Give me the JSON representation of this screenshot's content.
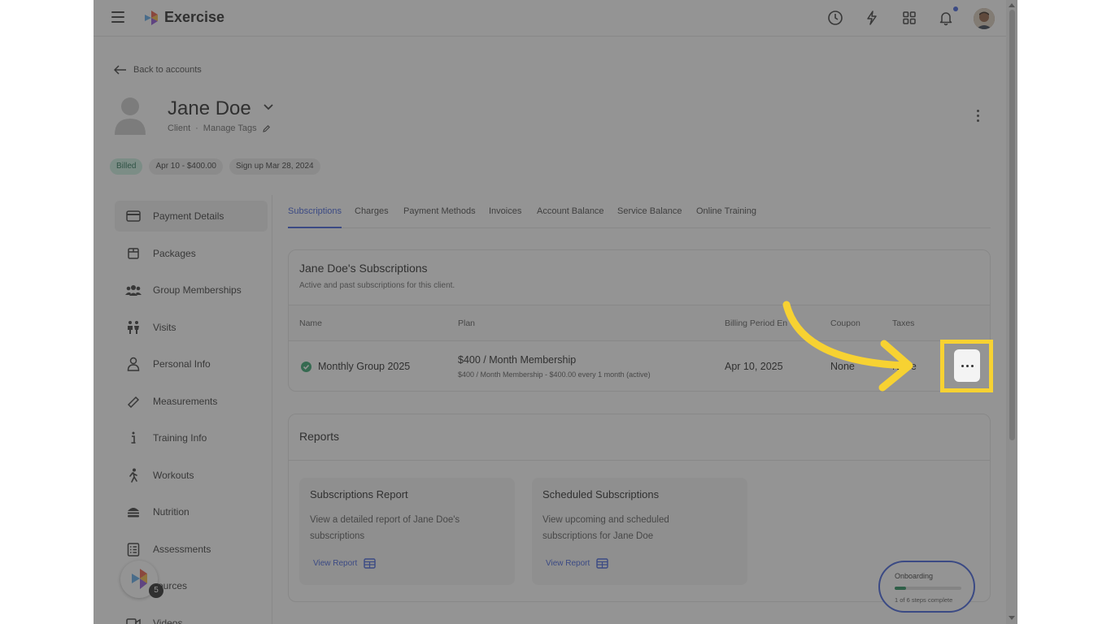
{
  "app": {
    "title": "Exercise"
  },
  "nav": {
    "back_label": "Back to accounts"
  },
  "client": {
    "name": "Jane Doe",
    "role": "Client",
    "separator": "·",
    "manage_tags": "Manage Tags"
  },
  "chips": {
    "billed": "Billed",
    "next_bill": "Apr 10 - $400.00",
    "signup": "Sign up Mar 28, 2024"
  },
  "sidebar": {
    "items": [
      {
        "label": "Payment Details",
        "icon": "credit-card-icon"
      },
      {
        "label": "Packages",
        "icon": "package-icon"
      },
      {
        "label": "Group Memberships",
        "icon": "group-icon"
      },
      {
        "label": "Visits",
        "icon": "visits-icon"
      },
      {
        "label": "Personal Info",
        "icon": "person-icon"
      },
      {
        "label": "Measurements",
        "icon": "ruler-icon"
      },
      {
        "label": "Training Info",
        "icon": "info-icon"
      },
      {
        "label": "Workouts",
        "icon": "running-icon"
      },
      {
        "label": "Nutrition",
        "icon": "burger-icon"
      },
      {
        "label": "Assessments",
        "icon": "checklist-icon"
      },
      {
        "label": "sources",
        "icon": "resources-icon"
      },
      {
        "label": "Videos",
        "icon": "video-icon"
      }
    ]
  },
  "tabs": [
    "Subscriptions",
    "Charges",
    "Payment Methods",
    "Invoices",
    "Account Balance",
    "Service Balance",
    "Online Training"
  ],
  "subscriptions": {
    "title": "Jane Doe's Subscriptions",
    "subtitle": "Active and past subscriptions for this client.",
    "columns": [
      "Name",
      "Plan",
      "Billing Period En",
      "Coupon",
      "Taxes"
    ],
    "row": {
      "name": "Monthly Group 2025",
      "plan": "$400 / Month Membership",
      "plan_detail": "$400 / Month Membership - $400.00 every 1 month (active)",
      "billing_end": "Apr 10, 2025",
      "coupon": "None",
      "taxes": "None"
    }
  },
  "reports": {
    "title": "Reports",
    "cards": [
      {
        "title": "Subscriptions Report",
        "desc": "View a detailed report of Jane Doe's subscriptions",
        "link": "View Report"
      },
      {
        "title": "Scheduled Subscriptions",
        "desc": "View upcoming and scheduled subscriptions for Jane Doe",
        "link": "View Report"
      }
    ]
  },
  "onboarding": {
    "title": "Onboarding",
    "progress": "1 of 6 steps complete",
    "fraction": 0.17
  },
  "fab": {
    "badge": "5"
  },
  "colors": {
    "accent": "#3b5bdb",
    "highlight": "#f7d232",
    "success": "#2fa36b"
  }
}
